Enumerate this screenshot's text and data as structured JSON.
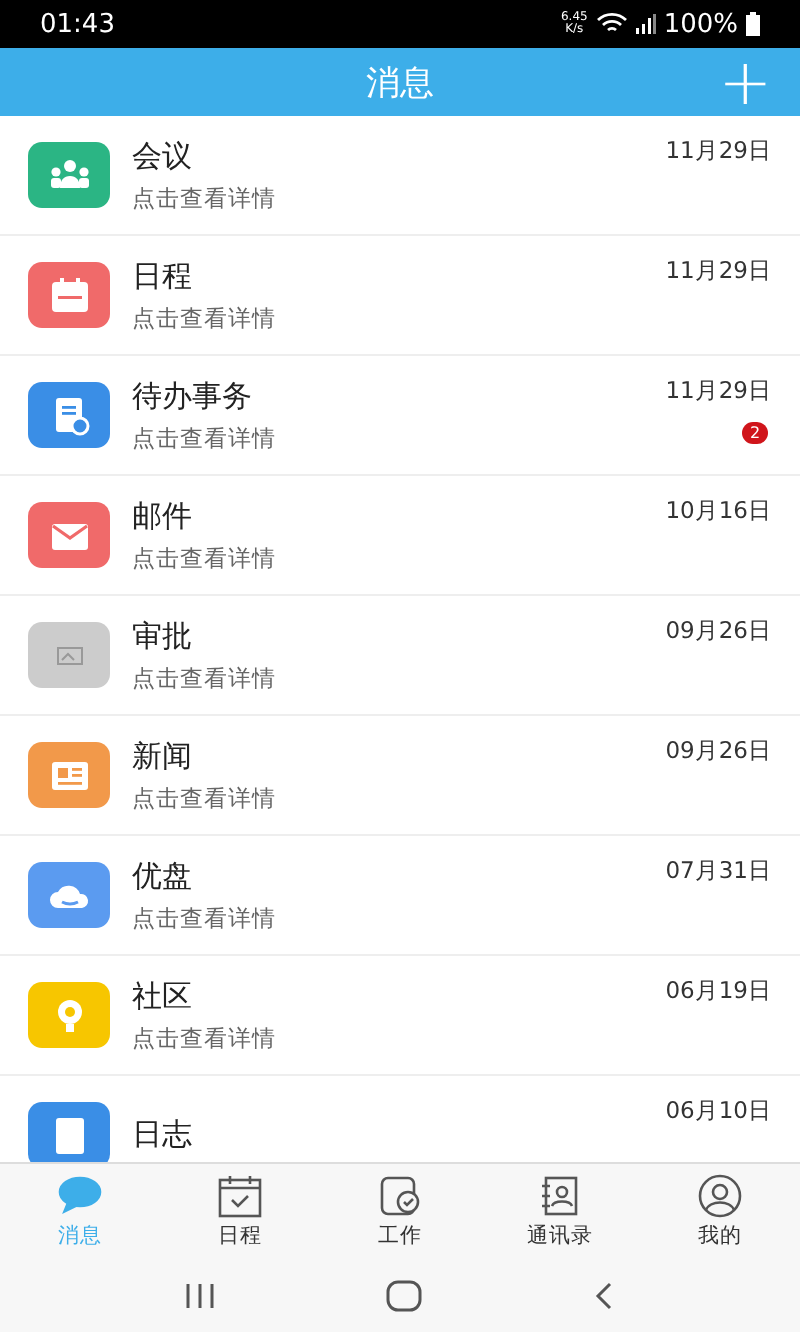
{
  "status_bar": {
    "time": "01:43",
    "speed": "6.45",
    "speed_unit": "K/s",
    "battery": "100%"
  },
  "header": {
    "title": "消息",
    "add": "+"
  },
  "messages": [
    {
      "title": "会议",
      "subtitle": "点击查看详情",
      "date": "11月29日",
      "kind": "meeting",
      "color": "#2bb584"
    },
    {
      "title": "日程",
      "subtitle": "点击查看详情",
      "date": "11月29日",
      "kind": "calendar",
      "color": "#f06a6a"
    },
    {
      "title": "待办事务",
      "subtitle": "点击查看详情",
      "date": "11月29日",
      "kind": "todo",
      "color": "#3a8ee6",
      "badge": "2"
    },
    {
      "title": "邮件",
      "subtitle": "点击查看详情",
      "date": "10月16日",
      "kind": "mail",
      "color": "#f06a6a"
    },
    {
      "title": "审批",
      "subtitle": "点击查看详情",
      "date": "09月26日",
      "kind": "image",
      "color": "#cccccc"
    },
    {
      "title": "新闻",
      "subtitle": "点击查看详情",
      "date": "09月26日",
      "kind": "news",
      "color": "#f2994a"
    },
    {
      "title": "优盘",
      "subtitle": "点击查看详情",
      "date": "07月31日",
      "kind": "cloud",
      "color": "#5b9bf0"
    },
    {
      "title": "社区",
      "subtitle": "点击查看详情",
      "date": "06月19日",
      "kind": "community",
      "color": "#f7c600"
    },
    {
      "title": "日志",
      "date": "06月10日",
      "kind": "log",
      "color": "#3a8ee6"
    }
  ],
  "tabs": [
    {
      "label": "消息",
      "kind": "chat",
      "selected": true
    },
    {
      "label": "日程",
      "kind": "calendar",
      "selected": false
    },
    {
      "label": "工作",
      "kind": "work",
      "selected": false
    },
    {
      "label": "通讯录",
      "kind": "contacts",
      "selected": false
    },
    {
      "label": "我的",
      "kind": "profile",
      "selected": false
    }
  ]
}
